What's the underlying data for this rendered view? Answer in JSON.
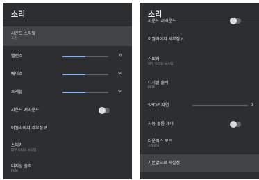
{
  "left": {
    "title": "소리",
    "items": [
      {
        "label": "사운드 스타일",
        "sub": "표준"
      },
      {
        "label": "밸런스",
        "value": "0",
        "level": 0.5
      },
      {
        "label": "베이스",
        "value": "50",
        "level": 0.5
      },
      {
        "label": "트레블",
        "value": "50",
        "level": 0.5
      },
      {
        "label": "사운드 서라운드",
        "toggle": "off"
      },
      {
        "label": "이퀄라이저 세부정보"
      },
      {
        "label": "스피커",
        "sub": "외부 오디오 시스템"
      },
      {
        "label": "디지털 출력",
        "sub": "PCM"
      }
    ]
  },
  "right": {
    "title": "소리",
    "items": [
      {
        "label": "사운드 서라운드",
        "toggle": "off"
      },
      {
        "label": "이퀄라이저 세부정보"
      },
      {
        "label": "스피커",
        "sub": "외부 오디오 시스템"
      },
      {
        "label": "디지털 출력",
        "sub": "PCM"
      },
      {
        "label": "SPDIF 지연",
        "value": "0",
        "level": 0.0
      },
      {
        "label": "자동 볼륨 제어",
        "toggle": "off"
      },
      {
        "label": "다운믹스 모드",
        "sub": "스테레오"
      },
      {
        "label": "기본값으로 재설정"
      }
    ]
  }
}
